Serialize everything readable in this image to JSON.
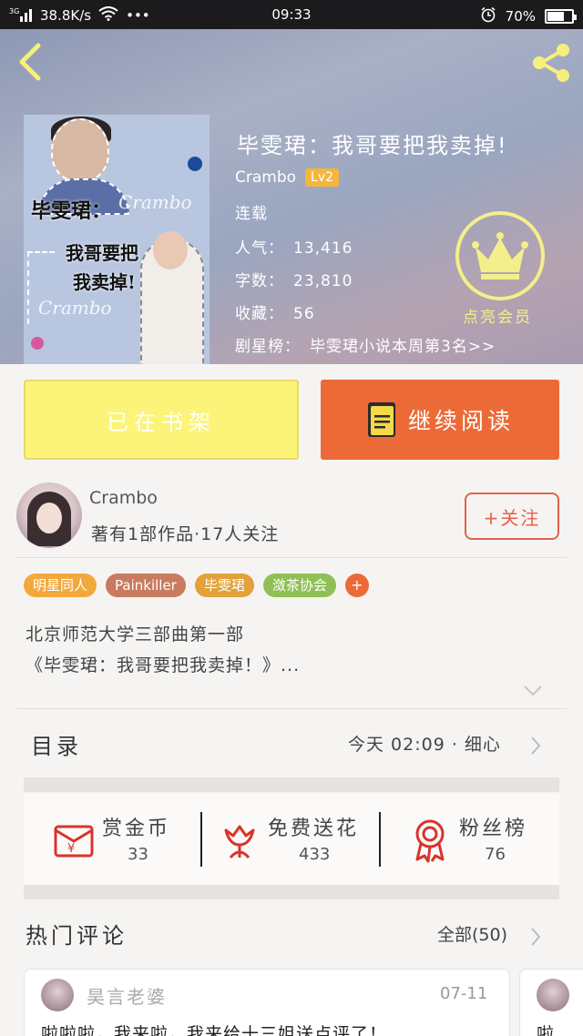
{
  "status_bar": {
    "network": "3G",
    "speed": "38.8K/s",
    "more": "•••",
    "time": "09:33",
    "battery": "70%",
    "battery_level": 0.7
  },
  "book": {
    "title": "毕雯珺：我哥要把我卖掉!",
    "author": "Crambo",
    "author_level": "Lv2",
    "status": "连载",
    "popularity_label": "人气：",
    "popularity": "13,416",
    "word_count_label": "字数：",
    "word_count": "23,810",
    "favorites_label": "收藏：",
    "favorites": "56",
    "rank_label": "剧星榜：",
    "rank_text": "毕雯珺小说本周第3名>>",
    "cover": {
      "title_line1": "毕雯珺：",
      "title_line2": "我哥要把",
      "title_line3": "我卖掉!",
      "watermark": "Crambo"
    }
  },
  "vip": {
    "label": "点亮会员",
    "icon": "crown-icon",
    "color": "#f4ef8a"
  },
  "actions": {
    "shelf_label": "已在书架",
    "read_label": "继续阅读",
    "read_color": "#ec6a37",
    "shelf_color": "#fbf478"
  },
  "author_card": {
    "name": "Crambo",
    "summary": "著有1部作品·17人关注",
    "follow_label": "+关注"
  },
  "tags": [
    {
      "label": "明星同人",
      "color": "#f2a93c"
    },
    {
      "label": "Painkiller",
      "color": "#c87b5e"
    },
    {
      "label": "毕雯珺",
      "color": "#e2a13a"
    },
    {
      "label": "潋茶协会",
      "color": "#8fbf55"
    }
  ],
  "tag_add": "+",
  "description": {
    "line1": "北京师范大学三部曲第一部",
    "line2": "《毕雯珺：我哥要把我卖掉！》..."
  },
  "toc": {
    "title": "目录",
    "update": "今天 02:09 · 细心"
  },
  "stats": [
    {
      "label": "赏金币",
      "value": "33",
      "icon": "red-envelope-icon"
    },
    {
      "label": "免费送花",
      "value": "433",
      "icon": "flower-icon"
    },
    {
      "label": "粉丝榜",
      "value": "76",
      "icon": "medal-icon"
    }
  ],
  "hot_comments": {
    "title": "热门评论",
    "all_label": "全部(50)",
    "items": [
      {
        "user": "昊言老婆",
        "date": "07-11",
        "text": "啦啦啦，我来啦，我来给十三姐送点评了！"
      },
      {
        "user": "",
        "date": "",
        "text": "啦"
      }
    ]
  }
}
